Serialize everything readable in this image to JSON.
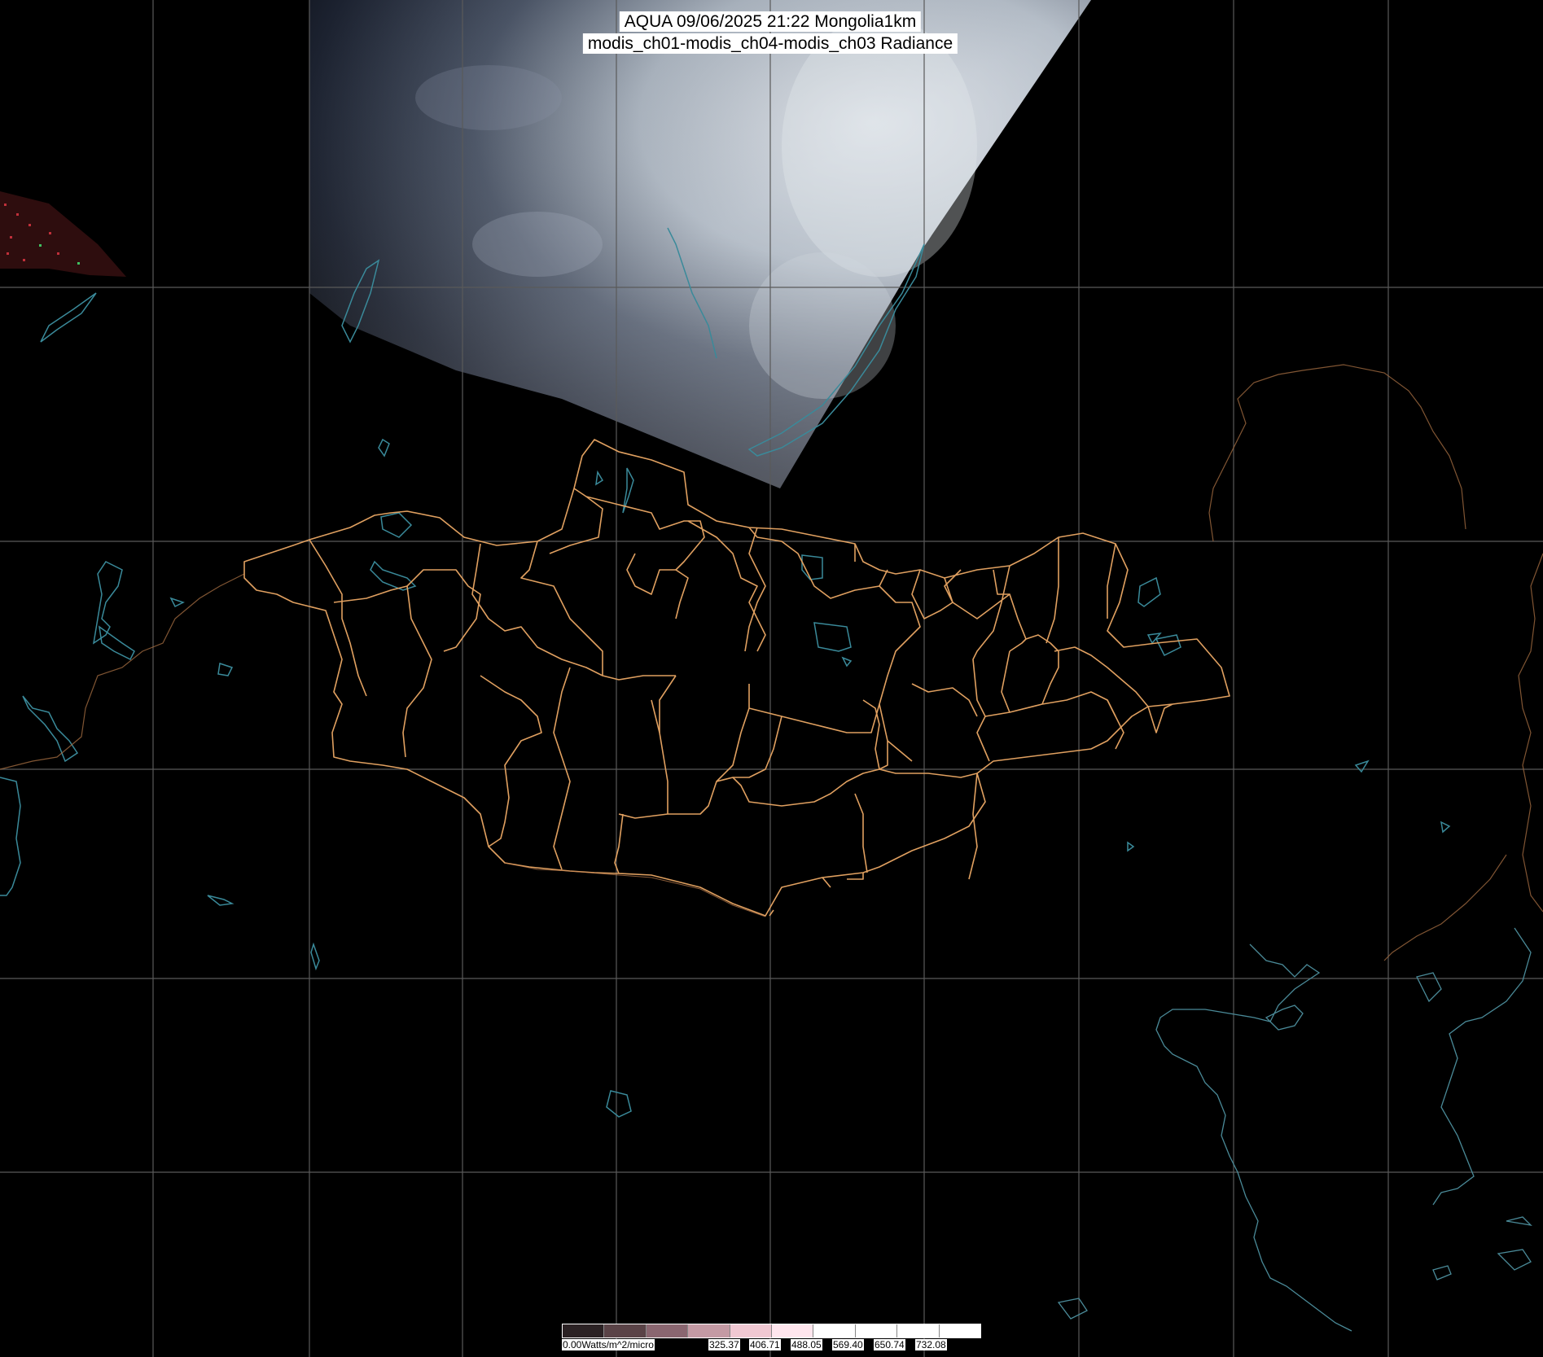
{
  "title": {
    "line1": "AQUA 09/06/2025 21:22 Mongolia1km",
    "line2": "modis_ch01-modis_ch04-modis_ch03 Radiance"
  },
  "legend": {
    "unit_label": "0.00Watts/m^2/micro",
    "ticks": [
      "325.37",
      "406.71",
      "488.05",
      "569.40",
      "650.74",
      "732.08"
    ],
    "colors": [
      "#2b2224",
      "#5a4347",
      "#8a6670",
      "#c49aa4",
      "#f0c8d2",
      "#ffe6ee",
      "#ffffff",
      "#ffffff",
      "#ffffff",
      "#ffffff"
    ]
  },
  "colors": {
    "background": "#000000",
    "grid": "#5a5a5a",
    "border": "#e0a060",
    "water": "#3a8a9a",
    "coast": "#5a9aa8"
  }
}
